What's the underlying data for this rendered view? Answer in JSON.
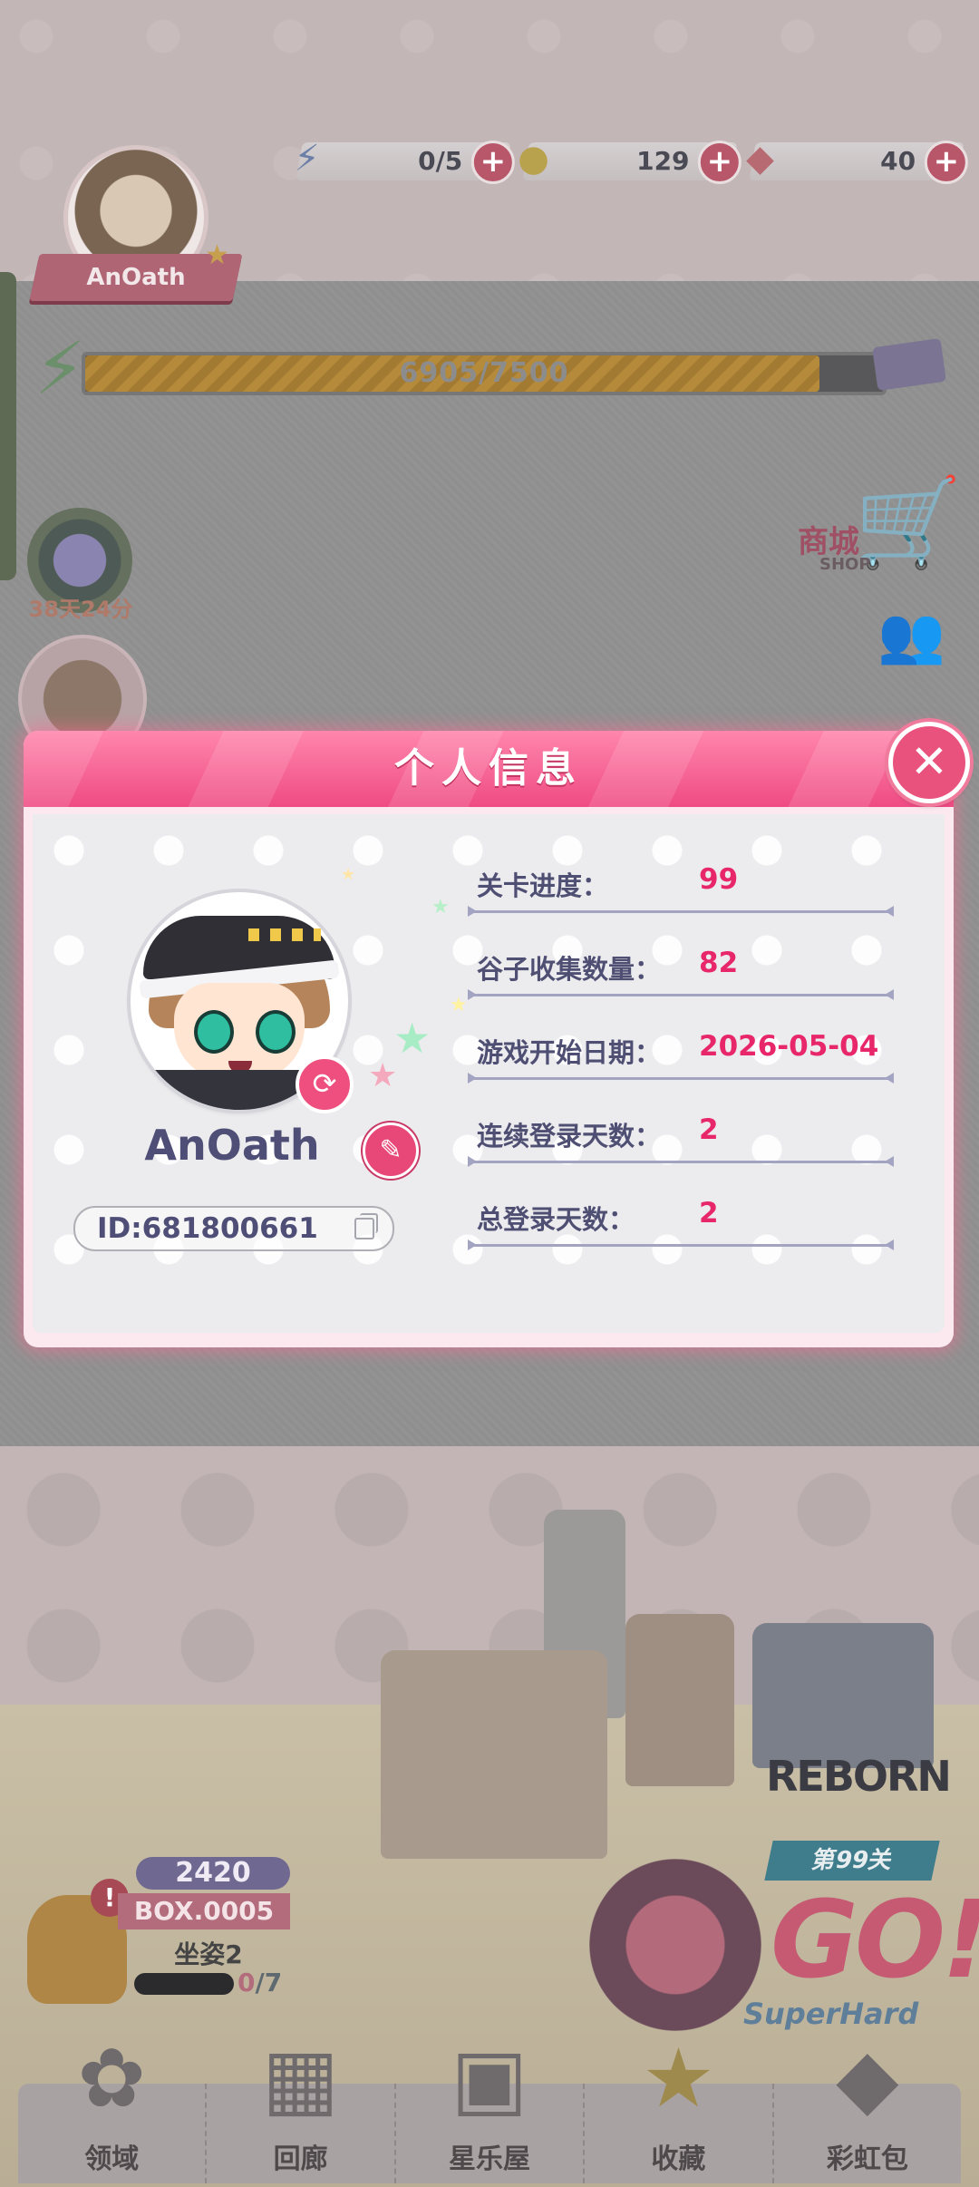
{
  "hud": {
    "player_name": "AnOath",
    "energy": "0/5",
    "coins": "129",
    "gems": "40",
    "exp_text": "6905/7500",
    "exp_progress": 0.92,
    "event_timer": "38天24分",
    "shop_label": "商城",
    "shop_sub": "SHOP"
  },
  "modal": {
    "title": "个人信息",
    "player_name": "AnOath",
    "player_id": "ID:681800661",
    "stats": [
      {
        "label": "关卡进度：",
        "value": "99"
      },
      {
        "label": "谷子收集数量：",
        "value": "82"
      },
      {
        "label": "游戏开始日期：",
        "value": "2026-05-04"
      },
      {
        "label": "连续登录天数：",
        "value": "2"
      },
      {
        "label": "总登录天数：",
        "value": "2"
      }
    ]
  },
  "box": {
    "score": "2420",
    "id": "BOX.0005",
    "name": "坐姿2",
    "count": "0",
    "total": "/7"
  },
  "stage": {
    "tag": "第99关",
    "go": "GO!",
    "difficulty": "SuperHard",
    "reborn": "REBORN"
  },
  "nav": [
    {
      "label": "领域",
      "icon": "domain-icon"
    },
    {
      "label": "回廊",
      "icon": "gallery-icon"
    },
    {
      "label": "星乐屋",
      "icon": "star-house-icon"
    },
    {
      "label": "收藏",
      "icon": "star-icon"
    },
    {
      "label": "彩虹包",
      "icon": "rainbow-pack-icon"
    }
  ],
  "colors": {
    "accent": "#ef4b83",
    "value_text": "#e8276a",
    "label_text": "#4f4f74"
  }
}
